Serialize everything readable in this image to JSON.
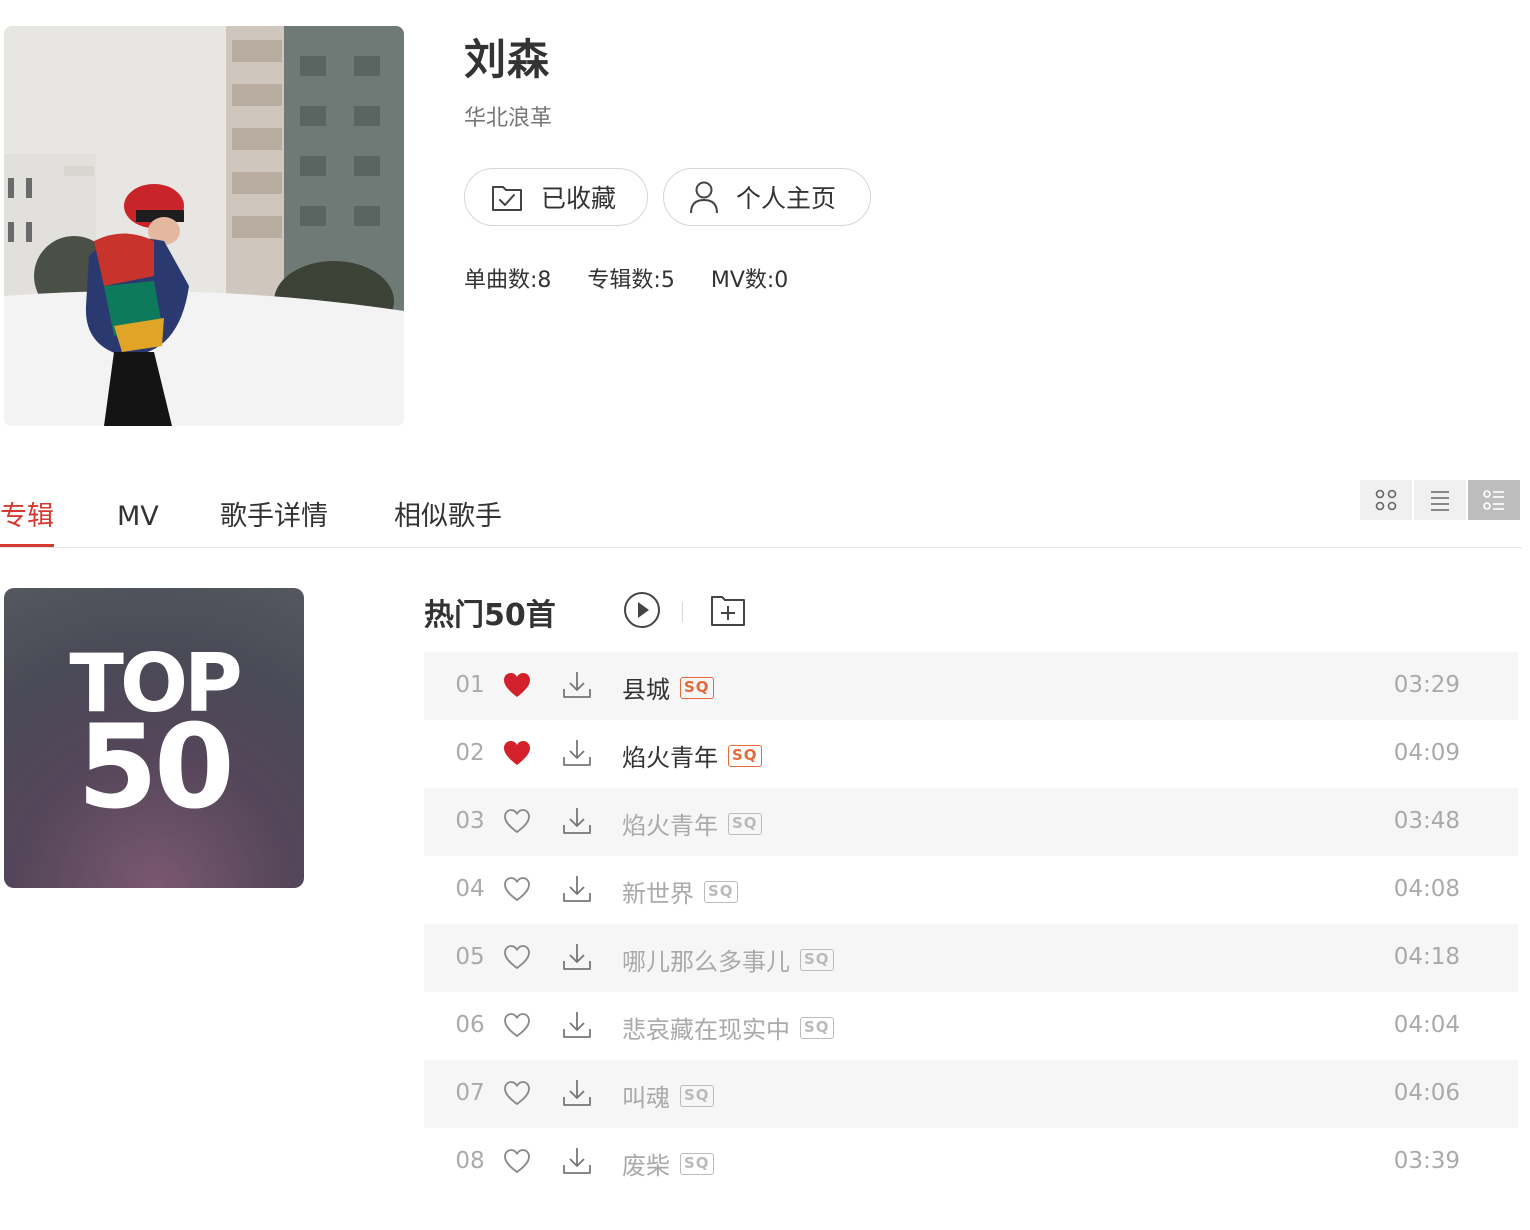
{
  "artist": {
    "name": "刘森",
    "alias": "华北浪革",
    "favorite_label": "已收藏",
    "homepage_label": "个人主页",
    "stats": {
      "songs": "单曲数:8",
      "albums": "专辑数:5",
      "mvs": "MV数:0"
    }
  },
  "tabs": [
    "专辑",
    "MV",
    "歌手详情",
    "相似歌手"
  ],
  "active_tab": "专辑",
  "view_modes": [
    "grid-view",
    "list-view",
    "detail-view"
  ],
  "active_view": "detail-view",
  "top50": {
    "line1": "TOP",
    "line2": "50"
  },
  "hot": {
    "title": "热门50首"
  },
  "colors": {
    "accent": "#d33a31",
    "sq_active": "#e46a3c",
    "muted": "#aaaaaa"
  },
  "tracks": [
    {
      "num": "01",
      "title": "县城",
      "badge": "SQ",
      "duration": "03:29",
      "liked": true,
      "available": true
    },
    {
      "num": "02",
      "title": "焰火青年",
      "badge": "SQ",
      "duration": "04:09",
      "liked": true,
      "available": true
    },
    {
      "num": "03",
      "title": "焰火青年",
      "badge": "SQ",
      "duration": "03:48",
      "liked": false,
      "available": false
    },
    {
      "num": "04",
      "title": "新世界",
      "badge": "SQ",
      "duration": "04:08",
      "liked": false,
      "available": false
    },
    {
      "num": "05",
      "title": "哪儿那么多事儿",
      "badge": "SQ",
      "duration": "04:18",
      "liked": false,
      "available": false
    },
    {
      "num": "06",
      "title": "悲哀藏在现实中",
      "badge": "SQ",
      "duration": "04:04",
      "liked": false,
      "available": false
    },
    {
      "num": "07",
      "title": "叫魂",
      "badge": "SQ",
      "duration": "04:06",
      "liked": false,
      "available": false
    },
    {
      "num": "08",
      "title": "废柴",
      "badge": "SQ",
      "duration": "03:39",
      "liked": false,
      "available": false
    }
  ]
}
